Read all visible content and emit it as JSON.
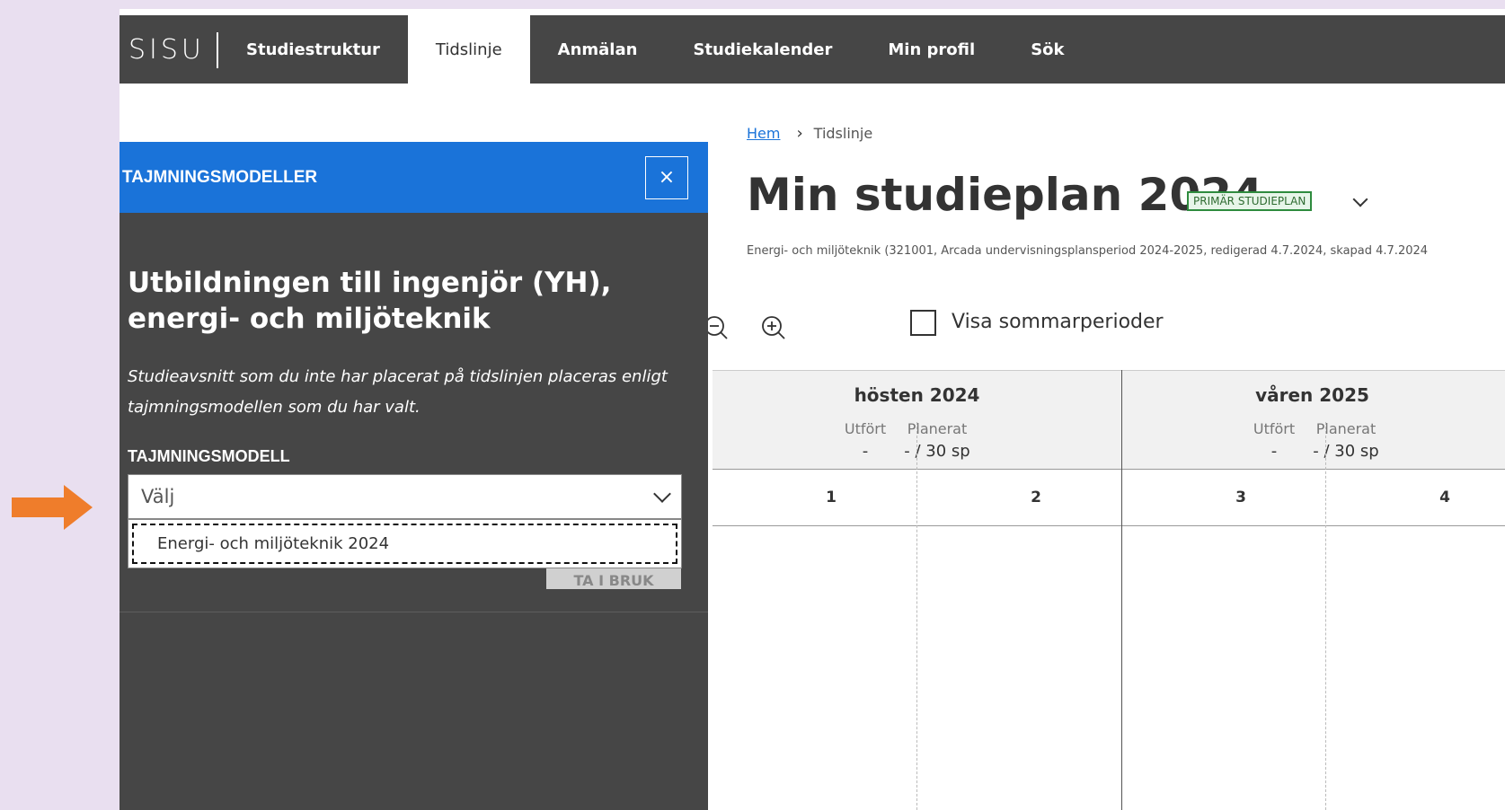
{
  "nav": {
    "logo": "SISU",
    "items": [
      "Studiestruktur",
      "Tidslinje",
      "Anmälan",
      "Studiekalender",
      "Min profil",
      "Sök"
    ],
    "active": "Tidslinje"
  },
  "panel": {
    "header": "TAJMNINGSMODELLER",
    "close_label": "×",
    "title": "Utbildningen till ingenjör (YH), energi- och miljöteknik",
    "description": "Studieavsnitt som du inte har placerat på tidslinjen placeras enligt tajmningsmodellen som du har valt.",
    "field_label": "TAJMNINGSMODELL",
    "select_value": "Välj",
    "option": "Energi- och miljöteknik 2024",
    "apply_label": "TA I BRUK"
  },
  "breadcrumb": {
    "home": "Hem",
    "current": "Tidslinje"
  },
  "plan": {
    "title": "Min studieplan 2024",
    "badge": "PRIMÄR STUDIEPLAN",
    "meta": "Energi- och miljöteknik (321001, Arcada undervisningsplansperiod 2024-2025, redigerad 4.7.2024, skapad 4.7.2024"
  },
  "toolbar": {
    "zoom_out_icon": "zoom-out-icon",
    "zoom_in_icon": "zoom-in-icon",
    "summer_label": "Visa sommarperioder"
  },
  "timeline": {
    "terms": [
      {
        "name": "hösten 2024",
        "done_label": "Utfört",
        "planned_label": "Planerat",
        "done_value": "-",
        "planned_value": "- / 30 sp"
      },
      {
        "name": "våren 2025",
        "done_label": "Utfört",
        "planned_label": "Planerat",
        "done_value": "-",
        "planned_value": "- / 30 sp"
      }
    ],
    "periods": [
      "1",
      "2",
      "3",
      "4"
    ]
  },
  "colors": {
    "nav_bg": "#464646",
    "panel_header": "#1a73d9",
    "accent_arrow": "#ef7d2b",
    "badge": "#2e8b3e"
  }
}
